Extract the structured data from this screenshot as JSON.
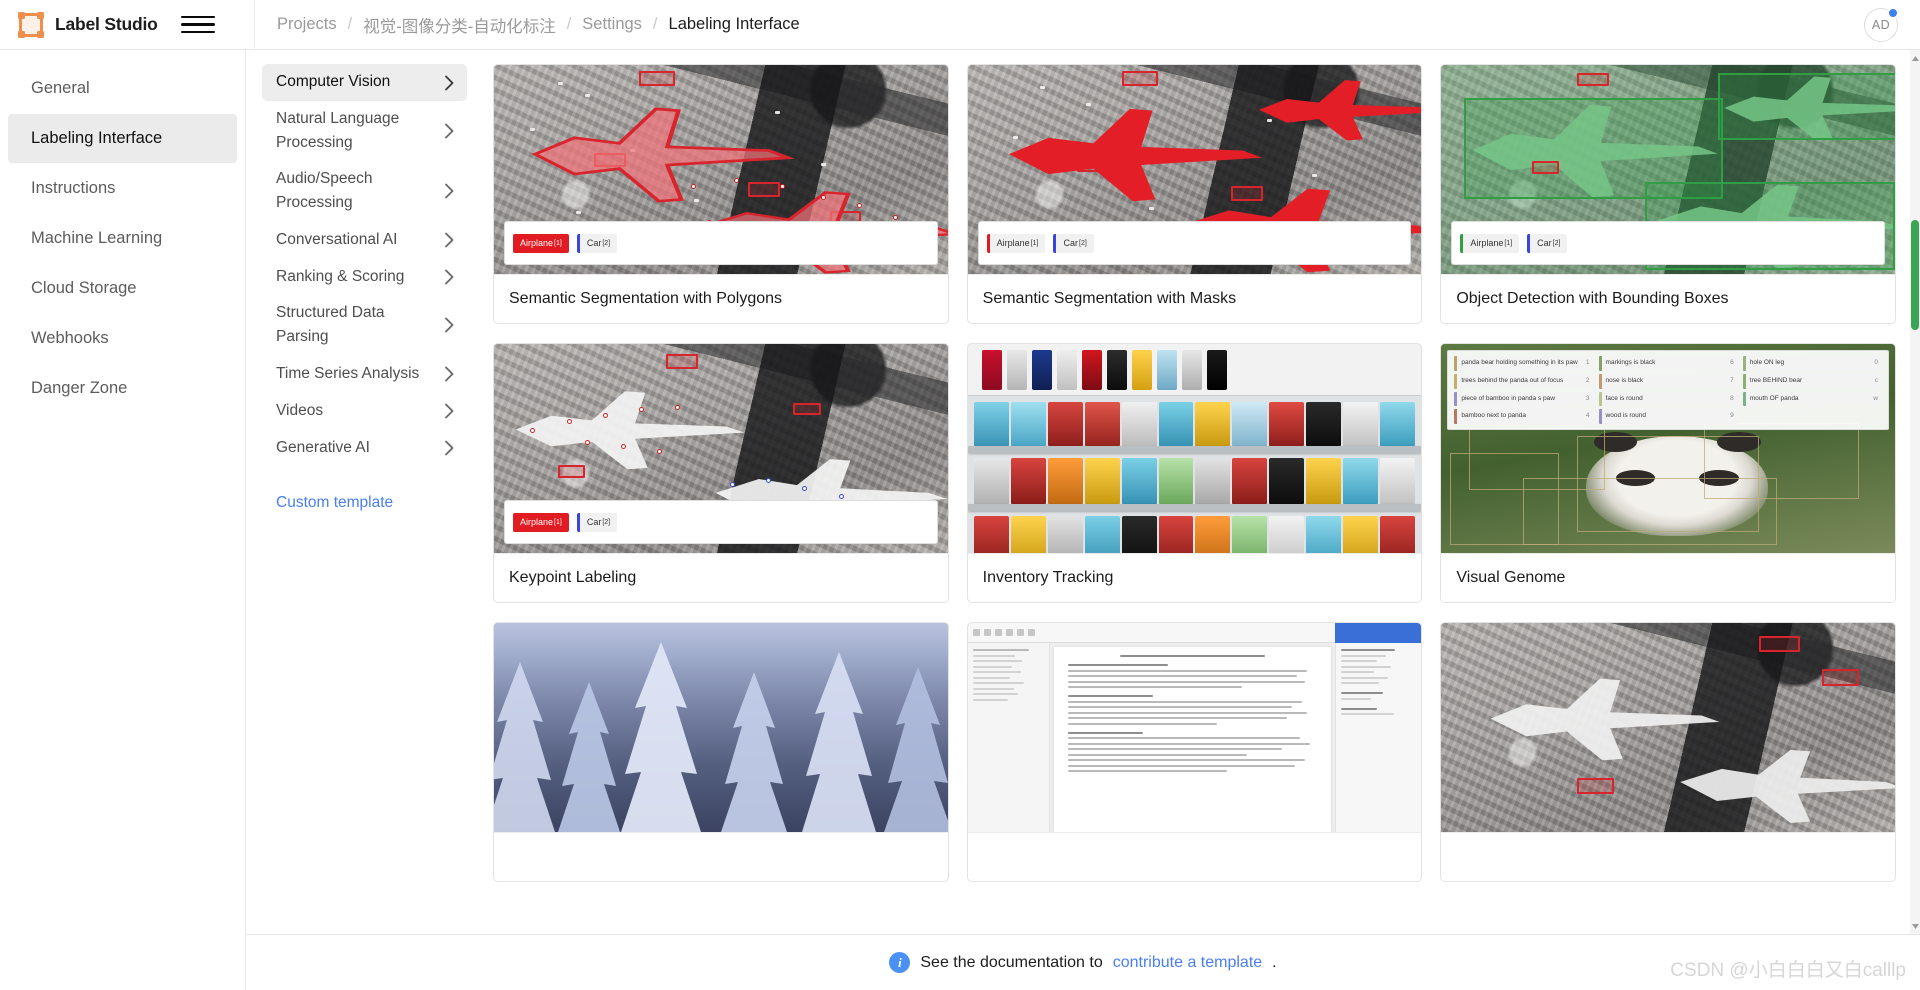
{
  "app": {
    "brand": "Label Studio",
    "logo_icon": "label-studio-logo-icon",
    "menu_icon": "hamburger-menu-icon"
  },
  "breadcrumb": {
    "items": [
      {
        "label": "Projects",
        "current": false
      },
      {
        "label": "视觉-图像分类-自动化标注",
        "current": false
      },
      {
        "label": "Settings",
        "current": false
      },
      {
        "label": "Labeling Interface",
        "current": true
      }
    ],
    "separator": "/"
  },
  "user": {
    "initials": "AD",
    "notification_dot": true,
    "dot_color": "#3f7ef3"
  },
  "settings_nav": {
    "items": [
      {
        "label": "General",
        "active": false
      },
      {
        "label": "Labeling Interface",
        "active": true
      },
      {
        "label": "Instructions",
        "active": false
      },
      {
        "label": "Machine Learning",
        "active": false
      },
      {
        "label": "Cloud Storage",
        "active": false
      },
      {
        "label": "Webhooks",
        "active": false
      },
      {
        "label": "Danger Zone",
        "active": false
      }
    ]
  },
  "categories": {
    "items": [
      {
        "label": "Computer Vision",
        "active": true,
        "chevron": "chevron-right-icon"
      },
      {
        "label": "Natural Language Processing",
        "active": false,
        "chevron": "chevron-right-icon"
      },
      {
        "label": "Audio/Speech Processing",
        "active": false,
        "chevron": "chevron-right-icon"
      },
      {
        "label": "Conversational AI",
        "active": false,
        "chevron": "chevron-right-icon"
      },
      {
        "label": "Ranking & Scoring",
        "active": false,
        "chevron": "chevron-right-icon"
      },
      {
        "label": "Structured Data Parsing",
        "active": false,
        "chevron": "chevron-right-icon"
      },
      {
        "label": "Time Series Analysis",
        "active": false,
        "chevron": "chevron-right-icon"
      },
      {
        "label": "Videos",
        "active": false,
        "chevron": "chevron-right-icon"
      },
      {
        "label": "Generative AI",
        "active": false,
        "chevron": "chevron-right-icon"
      }
    ],
    "custom_template_label": "Custom template"
  },
  "templates": {
    "cards": [
      {
        "title": "Semantic Segmentation with Polygons",
        "thumb": "polygons"
      },
      {
        "title": "Semantic Segmentation with Masks",
        "thumb": "masks"
      },
      {
        "title": "Object Detection with Bounding Boxes",
        "thumb": "bbox"
      },
      {
        "title": "Keypoint Labeling",
        "thumb": "keypoints"
      },
      {
        "title": "Inventory Tracking",
        "thumb": "inventory"
      },
      {
        "title": "Visual Genome",
        "thumb": "visual-genome"
      },
      {
        "title": "",
        "thumb": "snow-forest"
      },
      {
        "title": "",
        "thumb": "document"
      },
      {
        "title": "",
        "thumb": "aerial-planes"
      }
    ],
    "label_chips": {
      "airplane": "Airplane",
      "airplane_sup": "[1]",
      "car": "Car",
      "car_sup": "[2]"
    }
  },
  "visual_genome_annotations": [
    {
      "text": "panda bear holding something in its paw",
      "n": "1"
    },
    {
      "text": "markings is black",
      "n": "6"
    },
    {
      "text": "hole ON leg",
      "n": "0"
    },
    {
      "text": "trees behind the panda out of focus",
      "n": "2"
    },
    {
      "text": "nose is black",
      "n": "7"
    },
    {
      "text": "tree BEHIND bear",
      "n": "c"
    },
    {
      "text": "piece of bamboo in panda s paw",
      "n": "3"
    },
    {
      "text": "face is round",
      "n": "8"
    },
    {
      "text": "mouth OF panda",
      "n": "w"
    },
    {
      "text": "bamboo next to panda",
      "n": "4"
    },
    {
      "text": "wood is round",
      "n": "9"
    },
    {
      "text": "",
      "n": ""
    }
  ],
  "footer": {
    "text_before": "See the documentation to",
    "link_label": "contribute a template",
    "text_after": ".",
    "info_icon": "info-icon"
  },
  "watermark": "CSDN @小白白白又白calllp",
  "colors": {
    "accent_blue": "#4a7ef0",
    "brand_orange": "#f5a05a",
    "label_red": "#e01b22",
    "label_blue": "#3a46d8",
    "label_green": "#2f9e44",
    "scrollbar_green": "#3aa655",
    "active_bg": "#ebebeb"
  }
}
